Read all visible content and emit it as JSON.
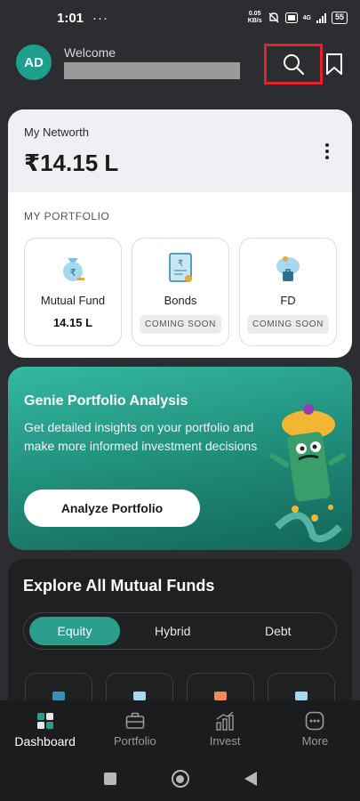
{
  "status_bar": {
    "time": "1:01",
    "dots": "···",
    "net_speed_value": "0.05",
    "net_speed_unit": "KB/s",
    "network_tag": "4G",
    "battery": "55"
  },
  "header": {
    "avatar_initials": "AD",
    "welcome_label": "Welcome",
    "search_icon": "search-icon",
    "bookmark_icon": "bookmark-icon",
    "highlight_color": "#e0242c"
  },
  "networth": {
    "label": "My Networth",
    "value": "₹14.15 L"
  },
  "portfolio": {
    "section_label": "MY PORTFOLIO",
    "tiles": [
      {
        "name": "Mutual Fund",
        "value": "14.15 L",
        "icon": "money-bag-icon"
      },
      {
        "name": "Bonds",
        "status": "COMING SOON",
        "icon": "bond-certificate-icon"
      },
      {
        "name": "FD",
        "status": "COMING SOON",
        "icon": "piggy-bank-icon"
      }
    ]
  },
  "genie": {
    "title": "Genie Portfolio Analysis",
    "description": "Get detailed insights on your portfolio and make more informed investment decisions",
    "button_label": "Analyze Portfolio",
    "illustration": "genie-mascot-illustration"
  },
  "explore": {
    "title": "Explore All Mutual Funds",
    "tabs": [
      {
        "label": "Equity",
        "active": true
      },
      {
        "label": "Hybrid",
        "active": false
      },
      {
        "label": "Debt",
        "active": false
      }
    ]
  },
  "bottom_nav": {
    "items": [
      {
        "label": "Dashboard",
        "icon": "dashboard-icon",
        "active": true
      },
      {
        "label": "Portfolio",
        "icon": "briefcase-icon",
        "active": false
      },
      {
        "label": "Invest",
        "icon": "invest-chart-icon",
        "active": false
      },
      {
        "label": "More",
        "icon": "more-icon",
        "active": false
      }
    ]
  },
  "colors": {
    "accent": "#2a9d8c",
    "background": "#2b2d30",
    "card": "#ffffff"
  }
}
